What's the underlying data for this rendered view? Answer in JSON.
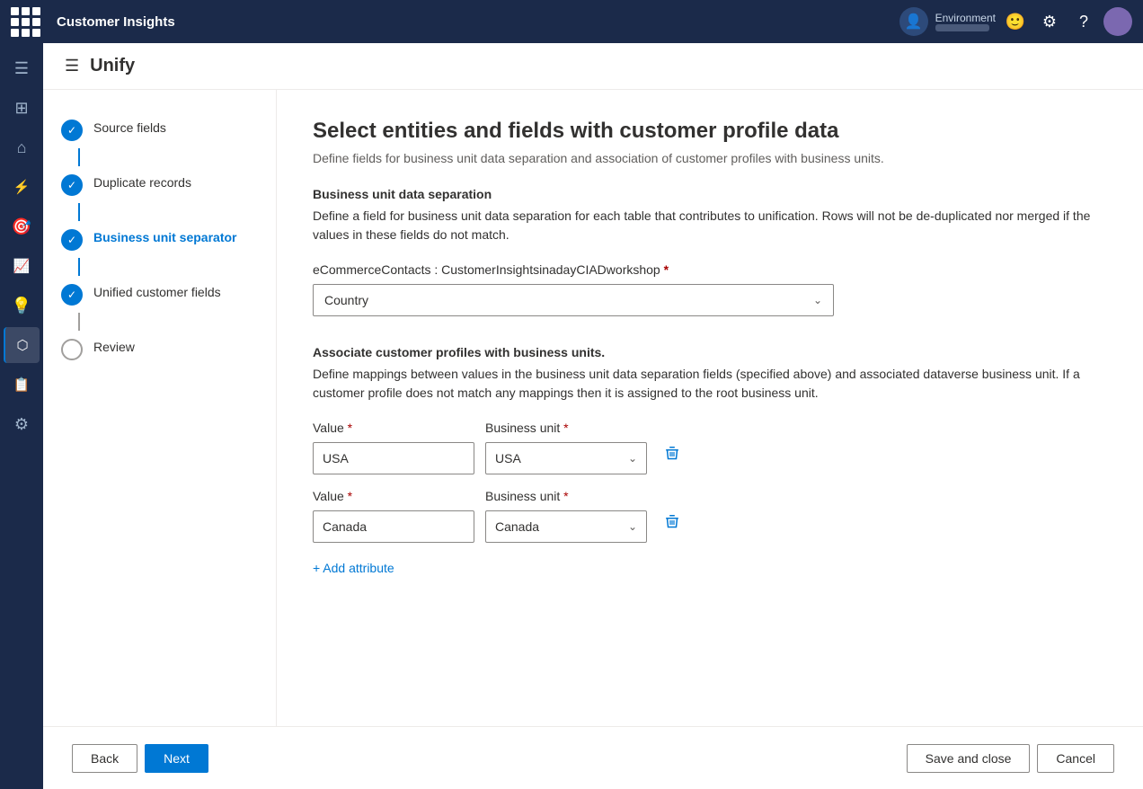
{
  "app": {
    "title": "Customer Insights",
    "grid_icon": "apps-icon"
  },
  "topnav": {
    "environment_label": "Environment",
    "environment_value_blur": "████ ██"
  },
  "page": {
    "title": "Unify"
  },
  "steps": [
    {
      "id": "source-fields",
      "label": "Source fields",
      "status": "completed"
    },
    {
      "id": "duplicate-records",
      "label": "Duplicate records",
      "status": "completed"
    },
    {
      "id": "business-unit-separator",
      "label": "Business unit separator",
      "status": "active"
    },
    {
      "id": "unified-customer-fields",
      "label": "Unified customer fields",
      "status": "completed"
    },
    {
      "id": "review",
      "label": "Review",
      "status": "empty"
    }
  ],
  "content": {
    "title": "Select entities and fields with customer profile data",
    "subtitle": "Define fields for business unit data separation and association of customer profiles with business units.",
    "business_unit_section": {
      "title": "Business unit data separation",
      "description": "Define a field for business unit data separation for each table that contributes to unification. Rows will not be de-duplicated nor merged if the values in these fields do not match.",
      "field_label": "eCommerceContacts : CustomerInsightsinadayCIADworkshop",
      "required_marker": "*",
      "dropdown_value": "Country"
    },
    "associate_section": {
      "title": "Associate customer profiles with business units.",
      "description": "Define mappings between values in the business unit data separation fields (specified above) and associated dataverse business unit. If a customer profile does not match any mappings then it is assigned to the root business unit.",
      "value_label": "Value",
      "business_unit_label": "Business unit",
      "required_marker": "*",
      "rows": [
        {
          "value": "USA",
          "business_unit": "USA"
        },
        {
          "value": "Canada",
          "business_unit": "Canada"
        }
      ],
      "add_attribute_label": "+ Add attribute"
    }
  },
  "bottom_bar": {
    "back_label": "Back",
    "next_label": "Next",
    "save_close_label": "Save and close",
    "cancel_label": "Cancel"
  },
  "sidebar_icons": [
    {
      "name": "home-icon",
      "symbol": "⌂"
    },
    {
      "name": "dashboard-icon",
      "symbol": "▦"
    },
    {
      "name": "analytics-icon",
      "symbol": "◈"
    },
    {
      "name": "insights-icon",
      "symbol": "◎"
    },
    {
      "name": "chart-icon",
      "symbol": "📈"
    },
    {
      "name": "bulb-icon",
      "symbol": "💡"
    },
    {
      "name": "data-icon",
      "symbol": "⬡"
    },
    {
      "name": "report-icon",
      "symbol": "📋"
    },
    {
      "name": "settings-icon",
      "symbol": "⚙"
    }
  ]
}
